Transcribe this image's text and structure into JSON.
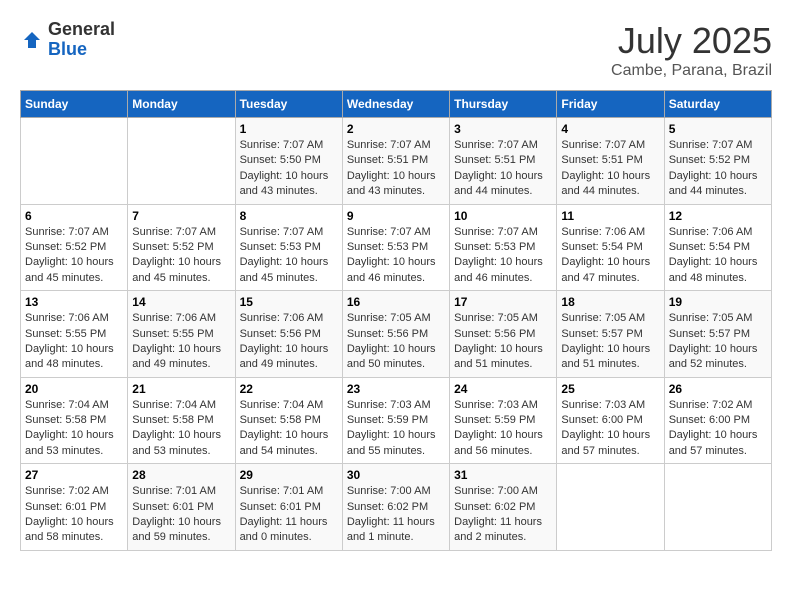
{
  "header": {
    "logo_general": "General",
    "logo_blue": "Blue",
    "month_title": "July 2025",
    "subtitle": "Cambe, Parana, Brazil"
  },
  "days_of_week": [
    "Sunday",
    "Monday",
    "Tuesday",
    "Wednesday",
    "Thursday",
    "Friday",
    "Saturday"
  ],
  "weeks": [
    [
      {
        "day": "",
        "info": ""
      },
      {
        "day": "",
        "info": ""
      },
      {
        "day": "1",
        "info": "Sunrise: 7:07 AM\nSunset: 5:50 PM\nDaylight: 10 hours\nand 43 minutes."
      },
      {
        "day": "2",
        "info": "Sunrise: 7:07 AM\nSunset: 5:51 PM\nDaylight: 10 hours\nand 43 minutes."
      },
      {
        "day": "3",
        "info": "Sunrise: 7:07 AM\nSunset: 5:51 PM\nDaylight: 10 hours\nand 44 minutes."
      },
      {
        "day": "4",
        "info": "Sunrise: 7:07 AM\nSunset: 5:51 PM\nDaylight: 10 hours\nand 44 minutes."
      },
      {
        "day": "5",
        "info": "Sunrise: 7:07 AM\nSunset: 5:52 PM\nDaylight: 10 hours\nand 44 minutes."
      }
    ],
    [
      {
        "day": "6",
        "info": "Sunrise: 7:07 AM\nSunset: 5:52 PM\nDaylight: 10 hours\nand 45 minutes."
      },
      {
        "day": "7",
        "info": "Sunrise: 7:07 AM\nSunset: 5:52 PM\nDaylight: 10 hours\nand 45 minutes."
      },
      {
        "day": "8",
        "info": "Sunrise: 7:07 AM\nSunset: 5:53 PM\nDaylight: 10 hours\nand 45 minutes."
      },
      {
        "day": "9",
        "info": "Sunrise: 7:07 AM\nSunset: 5:53 PM\nDaylight: 10 hours\nand 46 minutes."
      },
      {
        "day": "10",
        "info": "Sunrise: 7:07 AM\nSunset: 5:53 PM\nDaylight: 10 hours\nand 46 minutes."
      },
      {
        "day": "11",
        "info": "Sunrise: 7:06 AM\nSunset: 5:54 PM\nDaylight: 10 hours\nand 47 minutes."
      },
      {
        "day": "12",
        "info": "Sunrise: 7:06 AM\nSunset: 5:54 PM\nDaylight: 10 hours\nand 48 minutes."
      }
    ],
    [
      {
        "day": "13",
        "info": "Sunrise: 7:06 AM\nSunset: 5:55 PM\nDaylight: 10 hours\nand 48 minutes."
      },
      {
        "day": "14",
        "info": "Sunrise: 7:06 AM\nSunset: 5:55 PM\nDaylight: 10 hours\nand 49 minutes."
      },
      {
        "day": "15",
        "info": "Sunrise: 7:06 AM\nSunset: 5:56 PM\nDaylight: 10 hours\nand 49 minutes."
      },
      {
        "day": "16",
        "info": "Sunrise: 7:05 AM\nSunset: 5:56 PM\nDaylight: 10 hours\nand 50 minutes."
      },
      {
        "day": "17",
        "info": "Sunrise: 7:05 AM\nSunset: 5:56 PM\nDaylight: 10 hours\nand 51 minutes."
      },
      {
        "day": "18",
        "info": "Sunrise: 7:05 AM\nSunset: 5:57 PM\nDaylight: 10 hours\nand 51 minutes."
      },
      {
        "day": "19",
        "info": "Sunrise: 7:05 AM\nSunset: 5:57 PM\nDaylight: 10 hours\nand 52 minutes."
      }
    ],
    [
      {
        "day": "20",
        "info": "Sunrise: 7:04 AM\nSunset: 5:58 PM\nDaylight: 10 hours\nand 53 minutes."
      },
      {
        "day": "21",
        "info": "Sunrise: 7:04 AM\nSunset: 5:58 PM\nDaylight: 10 hours\nand 53 minutes."
      },
      {
        "day": "22",
        "info": "Sunrise: 7:04 AM\nSunset: 5:58 PM\nDaylight: 10 hours\nand 54 minutes."
      },
      {
        "day": "23",
        "info": "Sunrise: 7:03 AM\nSunset: 5:59 PM\nDaylight: 10 hours\nand 55 minutes."
      },
      {
        "day": "24",
        "info": "Sunrise: 7:03 AM\nSunset: 5:59 PM\nDaylight: 10 hours\nand 56 minutes."
      },
      {
        "day": "25",
        "info": "Sunrise: 7:03 AM\nSunset: 6:00 PM\nDaylight: 10 hours\nand 57 minutes."
      },
      {
        "day": "26",
        "info": "Sunrise: 7:02 AM\nSunset: 6:00 PM\nDaylight: 10 hours\nand 57 minutes."
      }
    ],
    [
      {
        "day": "27",
        "info": "Sunrise: 7:02 AM\nSunset: 6:01 PM\nDaylight: 10 hours\nand 58 minutes."
      },
      {
        "day": "28",
        "info": "Sunrise: 7:01 AM\nSunset: 6:01 PM\nDaylight: 10 hours\nand 59 minutes."
      },
      {
        "day": "29",
        "info": "Sunrise: 7:01 AM\nSunset: 6:01 PM\nDaylight: 11 hours\nand 0 minutes."
      },
      {
        "day": "30",
        "info": "Sunrise: 7:00 AM\nSunset: 6:02 PM\nDaylight: 11 hours\nand 1 minute."
      },
      {
        "day": "31",
        "info": "Sunrise: 7:00 AM\nSunset: 6:02 PM\nDaylight: 11 hours\nand 2 minutes."
      },
      {
        "day": "",
        "info": ""
      },
      {
        "day": "",
        "info": ""
      }
    ]
  ]
}
